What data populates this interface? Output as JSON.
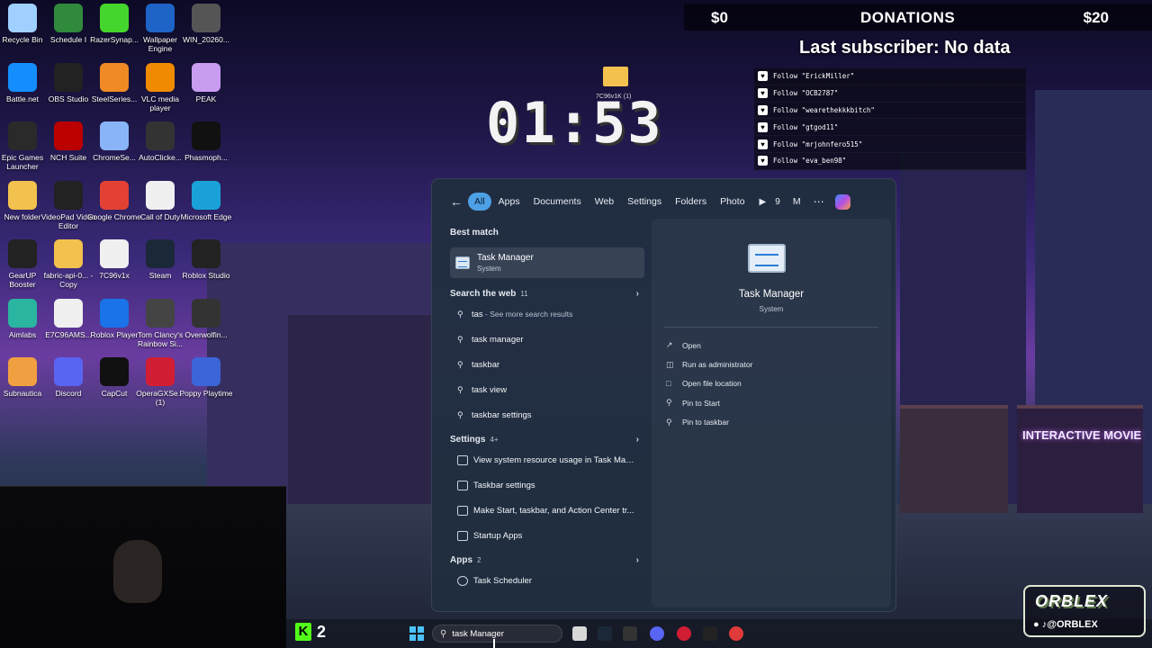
{
  "desktop_icons": [
    {
      "label": "Recycle Bin",
      "icon": "recycle-bin-icon"
    },
    {
      "label": "Schedule I",
      "icon": "schedule-i-icon"
    },
    {
      "label": "RazerSynap...",
      "icon": "razer-synapse-icon"
    },
    {
      "label": "Wallpaper Engine",
      "icon": "wallpaper-engine-icon"
    },
    {
      "label": "WIN_20260...",
      "icon": "image-file-icon"
    },
    {
      "label": "Battle.net",
      "icon": "battlenet-icon"
    },
    {
      "label": "OBS Studio",
      "icon": "obs-icon"
    },
    {
      "label": "SteelSeries...",
      "icon": "steelseries-icon"
    },
    {
      "label": "VLC media player",
      "icon": "vlc-icon"
    },
    {
      "label": "PEAK",
      "icon": "peak-icon"
    },
    {
      "label": "Epic Games Launcher",
      "icon": "epic-games-icon"
    },
    {
      "label": "NCH Suite",
      "icon": "nch-icon"
    },
    {
      "label": "ChromeSe...",
      "icon": "chrome-setup-icon"
    },
    {
      "label": "AutoClicke...",
      "icon": "autoclicker-icon"
    },
    {
      "label": "Phasmoph...",
      "icon": "phasmophobia-icon"
    },
    {
      "label": "New folder",
      "icon": "folder-icon"
    },
    {
      "label": "VideoPad Video Editor",
      "icon": "videopad-icon"
    },
    {
      "label": "Google Chrome",
      "icon": "chrome-icon"
    },
    {
      "label": "Call of Duty",
      "icon": "file-icon"
    },
    {
      "label": "Microsoft Edge",
      "icon": "edge-icon"
    },
    {
      "label": "GearUP Booster",
      "icon": "gearup-icon"
    },
    {
      "label": "fabric-api-0... - Copy",
      "icon": "folder-icon"
    },
    {
      "label": "7C96v1x",
      "icon": "file-icon"
    },
    {
      "label": "Steam",
      "icon": "steam-icon"
    },
    {
      "label": "Roblox Studio",
      "icon": "roblox-studio-icon"
    },
    {
      "label": "Aimlabs",
      "icon": "aimlabs-icon"
    },
    {
      "label": "E7C96AMS...",
      "icon": "file-icon"
    },
    {
      "label": "Roblox Player",
      "icon": "roblox-player-icon"
    },
    {
      "label": "Tom Clancy's Rainbow Si...",
      "icon": "rainbow-six-icon"
    },
    {
      "label": "Overwolfin...",
      "icon": "overwolf-icon"
    },
    {
      "label": "Subnautica",
      "icon": "subnautica-icon"
    },
    {
      "label": "Discord",
      "icon": "discord-icon"
    },
    {
      "label": "CapCut",
      "icon": "capcut-icon"
    },
    {
      "label": "OperaGXSe... (1)",
      "icon": "opera-gx-icon"
    },
    {
      "label": "Poppy Playtime",
      "icon": "poppy-playtime-icon"
    }
  ],
  "overlay": {
    "donations_left": "$0",
    "donations_title": "DONATIONS",
    "donations_right": "$20",
    "subscriber": "Last subscriber: No data",
    "follows": [
      "Follow \"ErickMiller\"",
      "Follow \"OCB2787\"",
      "Follow \"wearethekkkbitch\"",
      "Follow \"gtgod11\"",
      "Follow \"mrjohnfero515\"",
      "Follow \"eva_ben98\""
    ],
    "timer": "01:53",
    "folder_label": "7C96v1K (1)"
  },
  "search": {
    "filters": [
      "All",
      "Apps",
      "Documents",
      "Web",
      "Settings",
      "Folders",
      "Photo"
    ],
    "points": "9",
    "avatar": "M",
    "best_match_header": "Best match",
    "best_match_title": "Task Manager",
    "best_match_sub": "System",
    "web_header": "Search the web",
    "web_count": "11",
    "web_first_query": "tas",
    "web_first_hint": " - See more search results",
    "web_items": [
      "task manager",
      "taskbar",
      "task view",
      "taskbar settings"
    ],
    "settings_header": "Settings",
    "settings_count": "4+",
    "settings_items": [
      "View system resource usage in Task Man...",
      "Taskbar settings",
      "Make Start, taskbar, and Action Center tr...",
      "Startup Apps"
    ],
    "apps_header": "Apps",
    "apps_count": "2",
    "apps_items": [
      "Task Scheduler"
    ],
    "detail_title": "Task Manager",
    "detail_sub": "System",
    "actions": [
      "Open",
      "Run as administrator",
      "Open file location",
      "Pin to Start",
      "Pin to taskbar"
    ]
  },
  "taskbar": {
    "kick_count": "2",
    "search_value": "task Manager"
  },
  "brand": {
    "logo": "ORBLEX",
    "handle": "ORBLEX"
  }
}
